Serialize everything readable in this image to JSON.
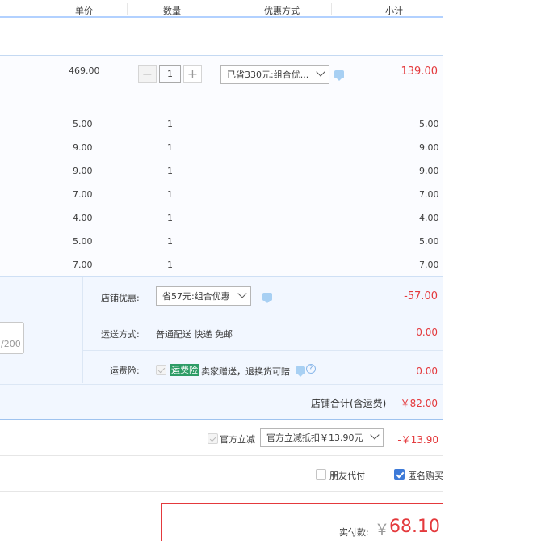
{
  "header": {
    "price_label": "单价",
    "qty_label": "数量",
    "discount_label": "优惠方式",
    "subtotal_label": "小计"
  },
  "main_item": {
    "price": "469.00",
    "qty": "1",
    "promo_select": "已省330元:组合优...",
    "subtotal": "139.00"
  },
  "sub_items": [
    {
      "price": "5.00",
      "qty": "1",
      "subtotal": "5.00"
    },
    {
      "price": "9.00",
      "qty": "1",
      "subtotal": "9.00"
    },
    {
      "price": "9.00",
      "qty": "1",
      "subtotal": "9.00"
    },
    {
      "price": "7.00",
      "qty": "1",
      "subtotal": "7.00"
    },
    {
      "price": "4.00",
      "qty": "1",
      "subtotal": "4.00"
    },
    {
      "price": "5.00",
      "qty": "1",
      "subtotal": "5.00"
    },
    {
      "price": "7.00",
      "qty": "1",
      "subtotal": "7.00"
    }
  ],
  "memo_counter": "/200",
  "shop": {
    "discount_label": "店铺优惠:",
    "discount_select": "省57元:组合优惠",
    "discount_amount": "-57.00",
    "shipping_label": "运送方式:",
    "shipping_value": "普通配送 快递 免邮",
    "shipping_amount": "0.00",
    "insurance_label": "运费险:",
    "insurance_tag": "运费险",
    "insurance_desc": "卖家赠送，退换货可赔",
    "insurance_amount": "0.00",
    "total_label": "店铺合计(含运费)",
    "total_amount": "￥82.00"
  },
  "official": {
    "checkbox_label": "官方立减",
    "select": "官方立减抵扣￥13.90元",
    "amount": "-￥13.90"
  },
  "options": {
    "friend_pay": "朋友代付",
    "anonymous": "匿名购买"
  },
  "payment": {
    "label": "实付款:",
    "currency": "￥",
    "amount": "68.10"
  },
  "colors": {
    "accent_red": "#e4393c",
    "header_border": "#b2d1ff",
    "checkbox_blue": "#3d7ad8",
    "insurance_green": "#2e9c66"
  }
}
